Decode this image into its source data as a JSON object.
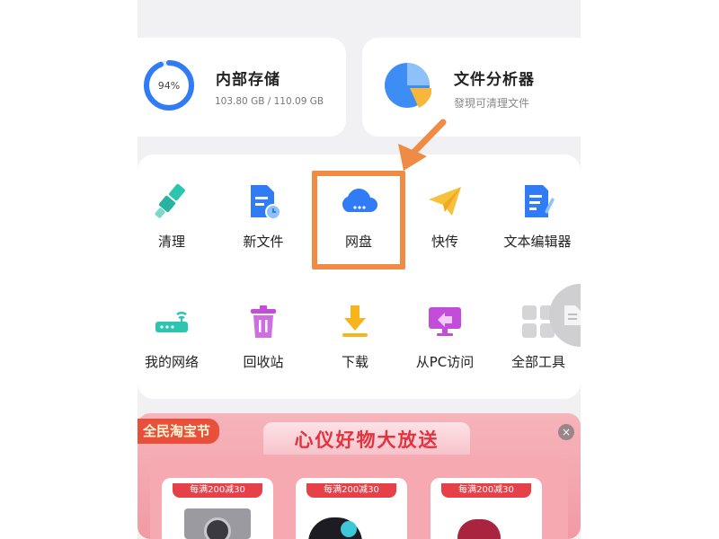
{
  "storage": {
    "percent_label": "94%",
    "percent_value": 94,
    "title": "内部存储",
    "usage": "103.80 GB / 110.09 GB"
  },
  "analyzer": {
    "title": "文件分析器",
    "subtitle": "發現可清理文件"
  },
  "tools": [
    {
      "label": "清理",
      "icon": "broom-icon"
    },
    {
      "label": "新文件",
      "icon": "new-file-icon"
    },
    {
      "label": "网盘",
      "icon": "cloud-drive-icon"
    },
    {
      "label": "快传",
      "icon": "paper-plane-icon"
    },
    {
      "label": "文本编辑器",
      "icon": "text-editor-icon"
    },
    {
      "label": "我的网络",
      "icon": "router-icon"
    },
    {
      "label": "回收站",
      "icon": "trash-icon"
    },
    {
      "label": "下载",
      "icon": "download-icon"
    },
    {
      "label": "从PC访问",
      "icon": "pc-access-icon"
    },
    {
      "label": "全部工具",
      "icon": "all-tools-icon"
    }
  ],
  "promo": {
    "tag": "全民淘宝节",
    "title": "心仪好物大放送",
    "close": "×",
    "deals": [
      "每满200减30",
      "每满200减30",
      "每满200减30"
    ]
  },
  "colors": {
    "accent_blue": "#2f7cf6",
    "highlight_orange": "#ef8b45",
    "promo_red": "#e4323f"
  }
}
